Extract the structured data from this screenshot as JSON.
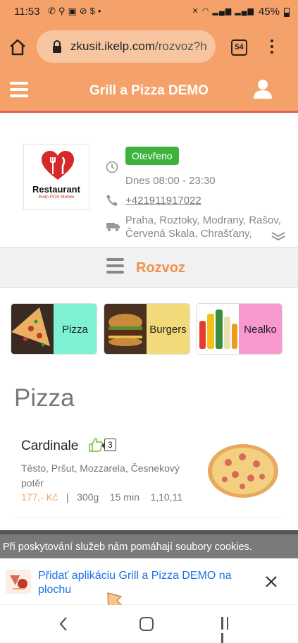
{
  "status_bar": {
    "time": "11:53",
    "left_icons": [
      "whatsapp-icon",
      "location-icon",
      "ai-icon",
      "block-icon",
      "s-icon",
      "dot-icon"
    ],
    "right_icons": [
      "mute-icon",
      "wifi-icon",
      "signal-icon-1",
      "signal-icon-2"
    ],
    "battery": "45%"
  },
  "browser": {
    "url_domain": "zkusit.ikelp.com",
    "url_path": "/rozvoz?h",
    "tab_count": "54"
  },
  "app": {
    "title": "Grill a Pizza DEMO",
    "accent_color": "#f4a26a",
    "header_border_color": "#e0625a"
  },
  "restaurant": {
    "logo_title": "Restaurant",
    "logo_subtitle": "iKelp POS Mobile",
    "status": "Otevřeno",
    "hours": "Dnes 08:00 - 23:30",
    "phone": "+421911917022",
    "delivery_areas": "Praha, Roztoky, Modrany, Rašov, Červená Skala, Chrašťany,"
  },
  "category_bar": {
    "label": "Rozvoz"
  },
  "categories": [
    {
      "label": "Pizza",
      "color": "#7ef2d2"
    },
    {
      "label": "Burgers",
      "color": "#f2d97a"
    },
    {
      "label": "Nealko",
      "color": "#f799cf"
    }
  ],
  "section": {
    "title": "Pizza"
  },
  "product": {
    "name": "Cardinale",
    "likes": "3",
    "description": "Těsto, Pršut, Mozzarela, Česnekový potěr",
    "price": "177,- Kč",
    "separator": "|",
    "weight": "300g",
    "time": "15 min",
    "allergens": "1,10,11"
  },
  "cookie_notice": {
    "text": "Při poskytování služeb nám pomáhají soubory cookies."
  },
  "add_to_home": {
    "text": "Přidať aplikáciu Grill a Pizza DEMO na plochu"
  }
}
